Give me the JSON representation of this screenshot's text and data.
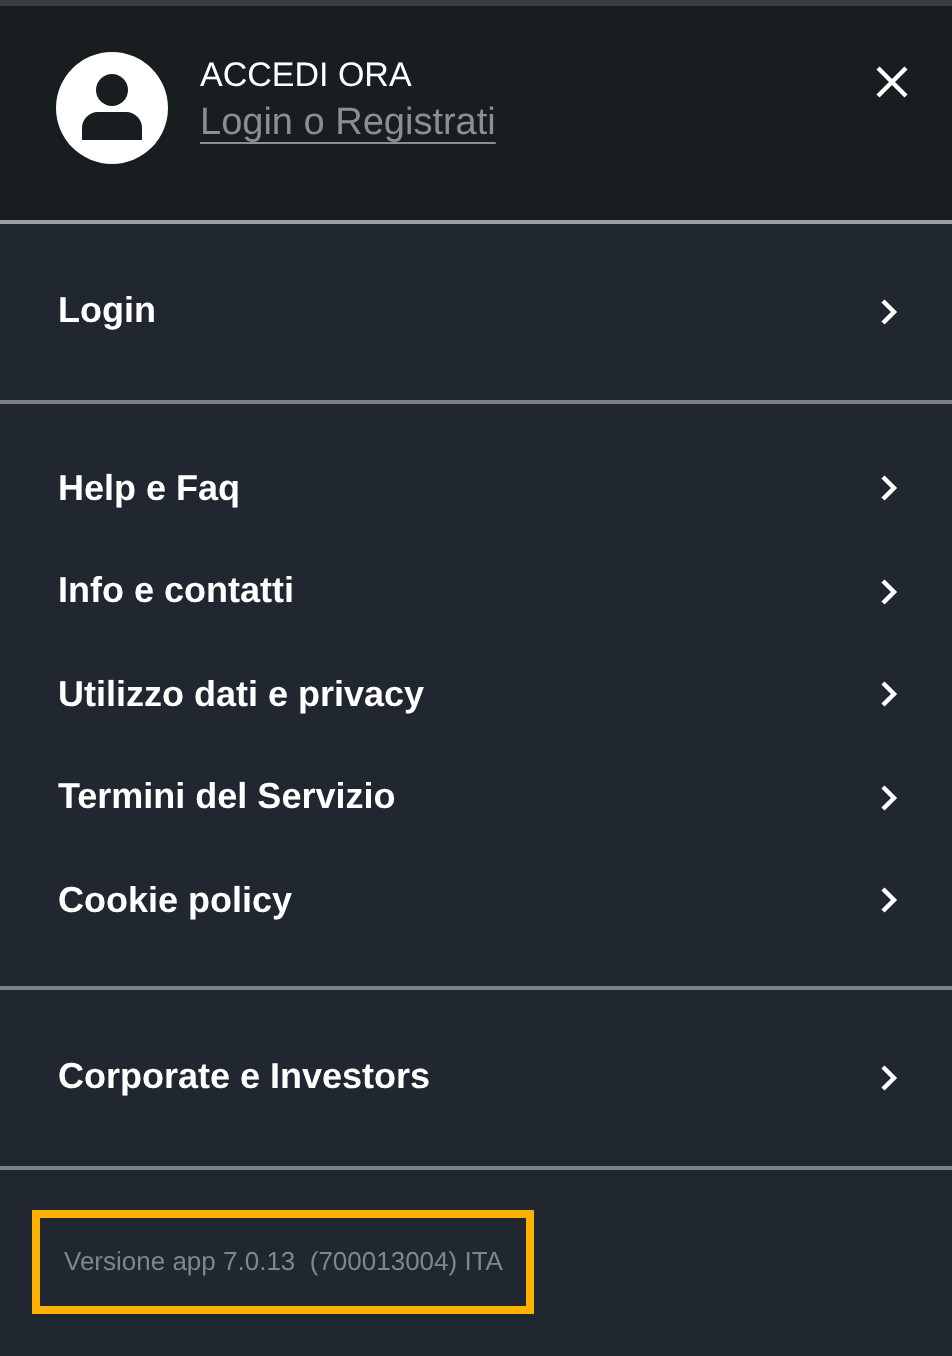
{
  "header": {
    "title": "ACCEDI ORA",
    "link": "Login o Registrati"
  },
  "sections": [
    {
      "items": [
        "Login"
      ]
    },
    {
      "items": [
        "Help e Faq",
        "Info e contatti",
        "Utilizzo dati e privacy",
        "Termini del Servizio",
        "Cookie policy"
      ]
    },
    {
      "items": [
        "Corporate e Investors"
      ]
    }
  ],
  "version": {
    "text": "Versione app 7.0.13  (700013004) ITA",
    "highlighted": true
  }
}
